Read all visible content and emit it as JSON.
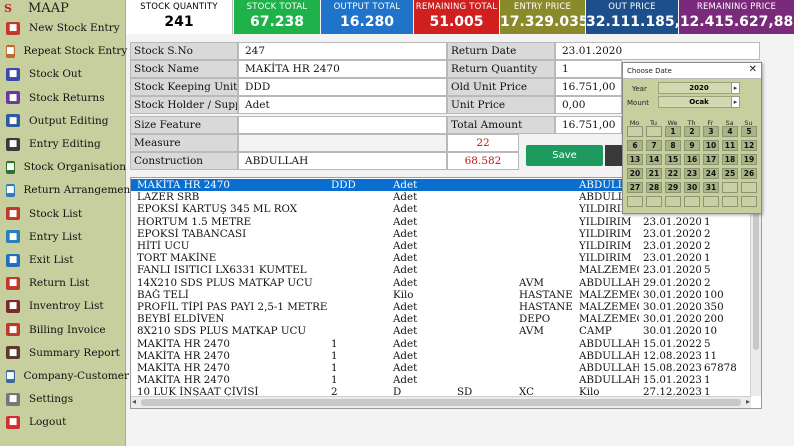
{
  "app": {
    "logo": "S",
    "title": "MAAP"
  },
  "colors": {
    "sidebar": "#c7cf9f",
    "selected_row": "#0a6ed1",
    "save_button": "#1f9a5f"
  },
  "nav": [
    {
      "label": "New Stock Entry",
      "icon": "new-entry-icon",
      "color": "#c0392b"
    },
    {
      "label": "Repeat Stock Entry",
      "icon": "repeat-entry-icon",
      "color": "#b86b2a"
    },
    {
      "label": "Stock Out",
      "icon": "stock-out-icon",
      "color": "#3b4aa8"
    },
    {
      "label": "Stock Returns",
      "icon": "stock-returns-icon",
      "color": "#6a3b9a"
    },
    {
      "label": "Output Editing",
      "icon": "output-editing-icon",
      "color": "#2c5aa0"
    },
    {
      "label": "Entry Editing",
      "icon": "entry-editing-icon",
      "color": "#3a3a3a"
    },
    {
      "label": "Stock Organisation",
      "icon": "stock-organisation-icon",
      "color": "#2f6f2f"
    },
    {
      "label": "Return Arrangement",
      "icon": "return-arrangement-icon",
      "color": "#2b7bbf"
    },
    {
      "label": "Stock List",
      "icon": "stock-list-icon",
      "color": "#c0392b"
    },
    {
      "label": "Entry List",
      "icon": "entry-list-icon",
      "color": "#2980b9"
    },
    {
      "label": "Exit List",
      "icon": "exit-list-icon",
      "color": "#1f6fbf"
    },
    {
      "label": "Return List",
      "icon": "return-list-icon",
      "color": "#c0392b"
    },
    {
      "label": "Inventroy List",
      "icon": "inventory-list-icon",
      "color": "#7b2a2a"
    },
    {
      "label": "Billing Invoice",
      "icon": "billing-invoice-icon",
      "color": "#c0392b"
    },
    {
      "label": "Summary Report",
      "icon": "summary-report-icon",
      "color": "#5a3a2a"
    },
    {
      "label": "Company-Customer",
      "icon": "company-customer-icon",
      "color": "#3a6a9a"
    },
    {
      "label": "Settings",
      "icon": "settings-icon",
      "color": "#777777"
    },
    {
      "label": "Logout",
      "icon": "logout-icon",
      "color": "#d03030"
    }
  ],
  "stats": [
    {
      "title": "STOCK QUANTITY",
      "value": "241",
      "bg": "#ffffff",
      "fg": "#000000"
    },
    {
      "title": "STOCK TOTAL",
      "value": "67.238",
      "bg": "#1fb24a",
      "fg": "#ffffff"
    },
    {
      "title": "OUTPUT TOTAL",
      "value": "16.280",
      "bg": "#1f73c8",
      "fg": "#ffffff"
    },
    {
      "title": "REMAINING TOTAL",
      "value": "51.005",
      "bg": "#cf1f1f",
      "fg": "#ffffff"
    },
    {
      "title": "ENTRY PRICE",
      "value": "17.329.035,20",
      "bg": "#8a8a2a",
      "fg": "#ffffff"
    },
    {
      "title": "OUT PRICE",
      "value": "32.111.185,45",
      "bg": "#1d4f8c",
      "fg": "#ffffff"
    },
    {
      "title": "REMAINING PRICE",
      "value": "12.415.627,88",
      "bg": "#7a2a7a",
      "fg": "#ffffff"
    }
  ],
  "form": {
    "stock_sno_label": "Stock S.No",
    "stock_sno": "247",
    "stock_name_label": "Stock Name",
    "stock_name": "MAKİTA HR 2470",
    "sku_label": "Stock Keeping Unit",
    "sku": "DDD",
    "holder_label": "Stock Holder / Supplier",
    "holder": "Adet",
    "size_label": "Size Feature",
    "size": "",
    "measure_label": "Measure",
    "measure": "22",
    "construction_label": "Construction",
    "construction": "ABDULLAH",
    "construction_value": "68.582",
    "return_date_label": "Return Date",
    "return_date": "23.01.2020",
    "return_qty_label": "Return Quantity",
    "return_qty": "1",
    "old_unit_price_label": "Old Unit Price",
    "old_unit_price": "16.751,00",
    "unit_price_label": "Unit Price",
    "unit_price": "0,00",
    "total_amount_label": "Total Amount",
    "total_amount": "16.751,00",
    "save_label": "Save"
  },
  "grid_rows": [
    [
      "MAKİTA HR 2470",
      "DDD",
      "Adet",
      "",
      "",
      "ABDULLAH",
      "",
      ""
    ],
    [
      "LAZER SRB",
      "",
      "Adet",
      "",
      "",
      "ABDULLAH",
      "",
      ""
    ],
    [
      "EPOKSİ KARTUŞ 345 ML ROX",
      "",
      "Adet",
      "",
      "",
      "YILDIRIM",
      "",
      ""
    ],
    [
      "HORTUM 1.5 METRE",
      "",
      "Adet",
      "",
      "",
      "YILDIRIM",
      "23.01.2020",
      "1"
    ],
    [
      "EPOKSİ TABANCASI",
      "",
      "Adet",
      "",
      "",
      "YILDIRIM",
      "23.01.2020",
      "2"
    ],
    [
      "HİTİ UCU",
      "",
      "Adet",
      "",
      "",
      "YILDIRIM",
      "23.01.2020",
      "2"
    ],
    [
      "TORT MAKİNE",
      "",
      "Adet",
      "",
      "",
      "YILDIRIM",
      "23.01.2020",
      "1"
    ],
    [
      "FANLI ISITICI LX6331 KUMTEL",
      "",
      "Adet",
      "",
      "",
      "MALZEMECİ",
      "23.01.2020",
      "5"
    ],
    [
      "14X210 SDS PLUS MATKAP UCU",
      "",
      "Adet",
      "",
      "AVM",
      "ABDULLAH",
      "29.01.2020",
      "2"
    ],
    [
      "BAĞ TELİ",
      "",
      "Kilo",
      "",
      "HASTANE",
      "MALZEMECİ",
      "30.01.2020",
      "100"
    ],
    [
      "PROFİL TİPİ PAS PAYI 2,5-1 METRE",
      "",
      "Adet",
      "",
      "HASTANE",
      "MALZEMECİ",
      "30.01.2020",
      "350"
    ],
    [
      "BEYBİ ELDİVEN",
      "",
      "Adet",
      "",
      "DEPO",
      "MALZEMECİ",
      "30.01.2020",
      "200"
    ],
    [
      "8X210 SDS PLUS MATKAP UCU",
      "",
      "Adet",
      "",
      "AVM",
      "CAMP",
      "30.01.2020",
      "10"
    ],
    [
      "MAKİTA HR 2470",
      "1",
      "Adet",
      "",
      "",
      "ABDULLAH",
      "15.01.2022",
      "5"
    ],
    [
      "MAKİTA HR 2470",
      "1",
      "Adet",
      "",
      "",
      "ABDULLAH",
      "12.08.2023",
      "11"
    ],
    [
      "MAKİTA HR 2470",
      "1",
      "Adet",
      "",
      "",
      "ABDULLAH",
      "15.08.2023",
      "67878"
    ],
    [
      "MAKİTA HR 2470",
      "1",
      "Adet",
      "",
      "",
      "ABDULLAH",
      "15.01.2023",
      "1"
    ],
    [
      "10 LUK İNŞAAT ÇİVİSİ",
      "2",
      "D",
      "SD",
      "XC",
      "Kilo",
      "27.12.2023",
      "1"
    ]
  ],
  "datepicker": {
    "title": "Choose Date",
    "close": "✕",
    "year_label": "Year",
    "year": "2020",
    "month_label": "Mount",
    "month": "Ocak",
    "dow": [
      "Mo",
      "Tu",
      "We",
      "Th",
      "Fr",
      "Sa",
      "Su"
    ],
    "days": [
      "",
      "",
      "1",
      "2",
      "3",
      "4",
      "5",
      "6",
      "7",
      "8",
      "9",
      "10",
      "11",
      "12",
      "13",
      "14",
      "15",
      "16",
      "17",
      "18",
      "19",
      "20",
      "21",
      "22",
      "23",
      "24",
      "25",
      "26",
      "27",
      "28",
      "29",
      "30",
      "31",
      "",
      "",
      "",
      "",
      "",
      "",
      "",
      "",
      ""
    ]
  }
}
